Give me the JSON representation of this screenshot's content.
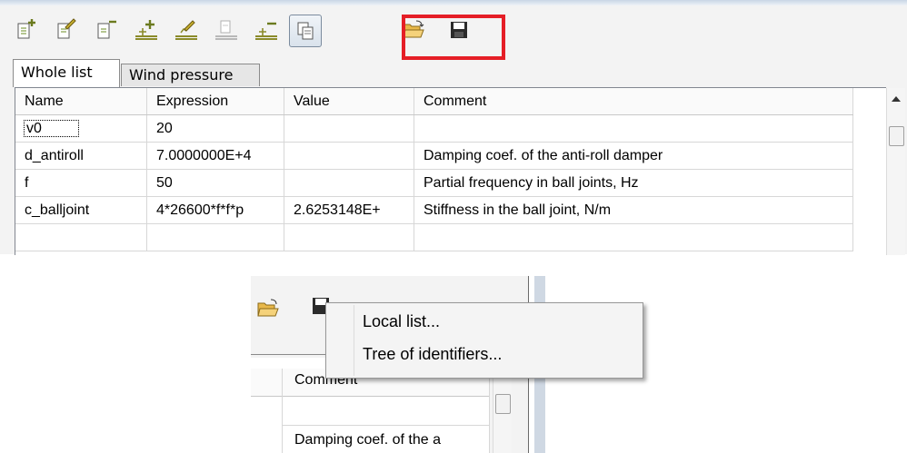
{
  "toolbar": {
    "buttons": [
      {
        "icon": "add-identifier-icon"
      },
      {
        "icon": "edit-identifier-icon"
      },
      {
        "icon": "delete-identifier-icon"
      },
      {
        "icon": "add-group-icon"
      },
      {
        "icon": "edit-group-icon"
      },
      {
        "icon": "delete-group-icon"
      },
      {
        "icon": "remove-group-icon"
      },
      {
        "icon": "copy-icon"
      },
      {
        "icon": "open-folder-icon"
      },
      {
        "icon": "save-icon"
      }
    ],
    "highlight_color": "#e51e26"
  },
  "tabs": [
    "Whole list",
    "Wind pressure"
  ],
  "table": {
    "columns": [
      "Name",
      "Expression",
      "Value",
      "Comment"
    ],
    "rows": [
      {
        "name": "v0",
        "expression": "20",
        "value": "",
        "comment": ""
      },
      {
        "name": "d_antiroll",
        "expression": "7.0000000E+4",
        "value": "",
        "comment": "Damping coef. of the anti-roll damper"
      },
      {
        "name": "f",
        "expression": "50",
        "value": "",
        "comment": "Partial frequency in ball joints, Hz"
      },
      {
        "name": "c_balljoint",
        "expression": "4*26600*f*f*p",
        "value": "2.6253148E+",
        "comment": "Stiffness in the ball joint, N/m"
      }
    ]
  },
  "zoom_view": {
    "header": "Comment",
    "cell": "Damping coef. of the a"
  },
  "context_menu": {
    "items": [
      "Local list...",
      "Tree of identifiers..."
    ]
  }
}
